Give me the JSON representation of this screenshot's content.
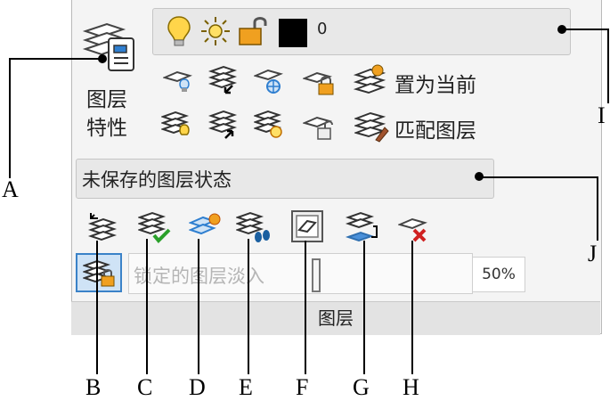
{
  "panel": {
    "title": "图层",
    "properties_button": {
      "line1": "图层",
      "line2": "特性"
    },
    "current_layer": {
      "name": "0",
      "color": "#000000"
    },
    "set_current_label": "置为当前",
    "match_layer_label": "匹配图层",
    "layer_state": "未保存的图层状态",
    "lock_fade_placeholder": "锁定的图层淡入",
    "lock_fade_value": "50%"
  },
  "callouts": [
    "A",
    "B",
    "C",
    "D",
    "E",
    "F",
    "G",
    "H",
    "I",
    "J"
  ],
  "icons": {
    "bulb": "lightbulb-icon",
    "sun": "sun-icon",
    "lock": "unlock-icon",
    "accent_orange": "#f0a020",
    "accent_blue": "#2f7fd0",
    "accent_green": "#2aa02a",
    "accent_red": "#d02020"
  }
}
